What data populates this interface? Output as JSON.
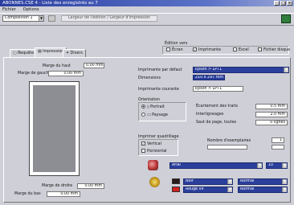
{
  "window": {
    "title": "ABONNES.CSE 4 - Liste des enregistrés au 7"
  },
  "menu": [
    "Fichier",
    "Options"
  ],
  "toolbar": {
    "composition": "Composition 1",
    "header_text": "Largeur de l'édition / Largeur d'impression"
  },
  "edition_vers": {
    "label": "Édition vers",
    "options": [
      {
        "label": "Écran",
        "checked": false
      },
      {
        "label": "Imprimante",
        "checked": true
      },
      {
        "label": "Excel",
        "checked": false
      },
      {
        "label": "Fichier disque",
        "checked": false
      }
    ]
  },
  "tabs": [
    "Requête",
    "Impression",
    "Divers"
  ],
  "margins": {
    "top_label": "Marge du haut",
    "top_value": "0.00 mm",
    "left_label": "Marge de gauche",
    "left_value": "0.00 mm",
    "right_label": "Marge de droite",
    "right_value": "0.00 mm",
    "bottom_label": "Marge du bas",
    "bottom_value": "0.00 mm"
  },
  "printer": {
    "default_label": "Imprimante par défaut",
    "default_value": "Epson > LPT1",
    "dimensions_label": "Dimensions",
    "dimensions_value": "210 x 297 mm",
    "current_label": "Imprimante courante",
    "current_value": "Epson > LPT1"
  },
  "orientation": {
    "label": "Orientation",
    "portrait": "Portrait",
    "paysage": "Paysage"
  },
  "spacing": {
    "lines_label": "Écartement des traits",
    "lines_value": "0.5 mm",
    "interline_label": "Interligneages",
    "interline_value": "2.0 mm",
    "page_break_label": "Saut de page, toutes",
    "page_break_value": "0 lignes"
  },
  "quality": {
    "label": "Imprimer quadrillage",
    "vertical": "Vertical",
    "horizontal": "Horizontal",
    "copies_label": "Nombre d'exemplaires",
    "copies_value": "1"
  },
  "font_row": {
    "font": "Arial",
    "size": "10"
  },
  "color_rows": [
    {
      "color": "#2a1a1a",
      "name": "Noir",
      "style": "Normal"
    },
    {
      "color": "#d02020",
      "name": "Rouge vif",
      "style": "Normal"
    }
  ]
}
